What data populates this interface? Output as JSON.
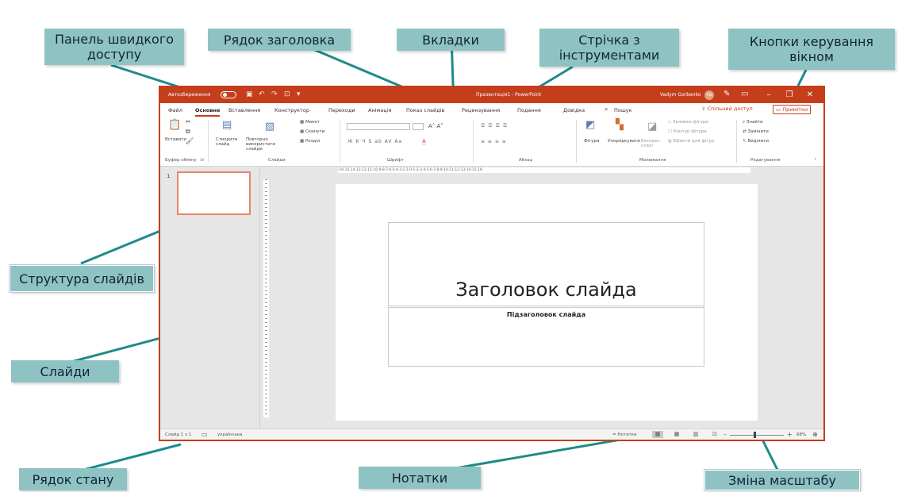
{
  "callouts": {
    "qat": "Панель швидкого доступу",
    "title_bar": "Рядок заголовка",
    "tabs": "Вкладки",
    "ribbon": "Стрічка з інструментами",
    "window_controls": "Кнопки керування вікном",
    "slide_structure": "Структура слайдів",
    "slides": "Слайди",
    "status_bar": "Рядок стану",
    "notes": "Нотатки",
    "zoom": "Зміна масштабу"
  },
  "window": {
    "autosave": "Автозбереження",
    "doc_title": "Презентація1 - PowerPoint",
    "user": "Vadym Gorbenko",
    "user_initials": "VG"
  },
  "tabs": [
    "Файл",
    "Основне",
    "Вставлення",
    "Конструктор",
    "Переходи",
    "Анімація",
    "Показ слайдів",
    "Рецензування",
    "Подання",
    "Довідка",
    "Пошук"
  ],
  "share": "Спільний доступ",
  "comments": "Примітки",
  "ribbon": {
    "paste": "Вставити",
    "clipboard_group": "Буфер обміну",
    "new_slide": "Створити слайд",
    "reuse_slides": "Повторно використати слайди",
    "layout": "Макет",
    "reset": "Скинути",
    "section": "Розділ",
    "slides_group": "Слайди",
    "font_group": "Шрифт",
    "paragraph_group": "Абзац",
    "shapes": "Фігури",
    "arrange": "Упорядкувати",
    "quick_styles": "Експрес-стилі",
    "shape_fill": "Заливка фігури",
    "shape_outline": "Контур фігури",
    "shape_effects": "Ефекти для фігур",
    "drawing_group": "Малювання",
    "find": "Знайти",
    "replace": "Замінити",
    "select": "Виділити",
    "editing_group": "Редагування"
  },
  "ruler": "·16·15·14·13·12·11·10·9·8·7·6·5·4·3·2·1·0·1·2·3·4·5·6·7·8·9·10·11·12·13·14·15·16·",
  "thumbnail_number": "1",
  "slide": {
    "title": "Заголовок слайда",
    "subtitle": "Підзаголовок слайда"
  },
  "status": {
    "slide_counter": "Слайд 1 з 1",
    "language": "українська",
    "notes": "Нотатки",
    "zoom": "68%"
  }
}
